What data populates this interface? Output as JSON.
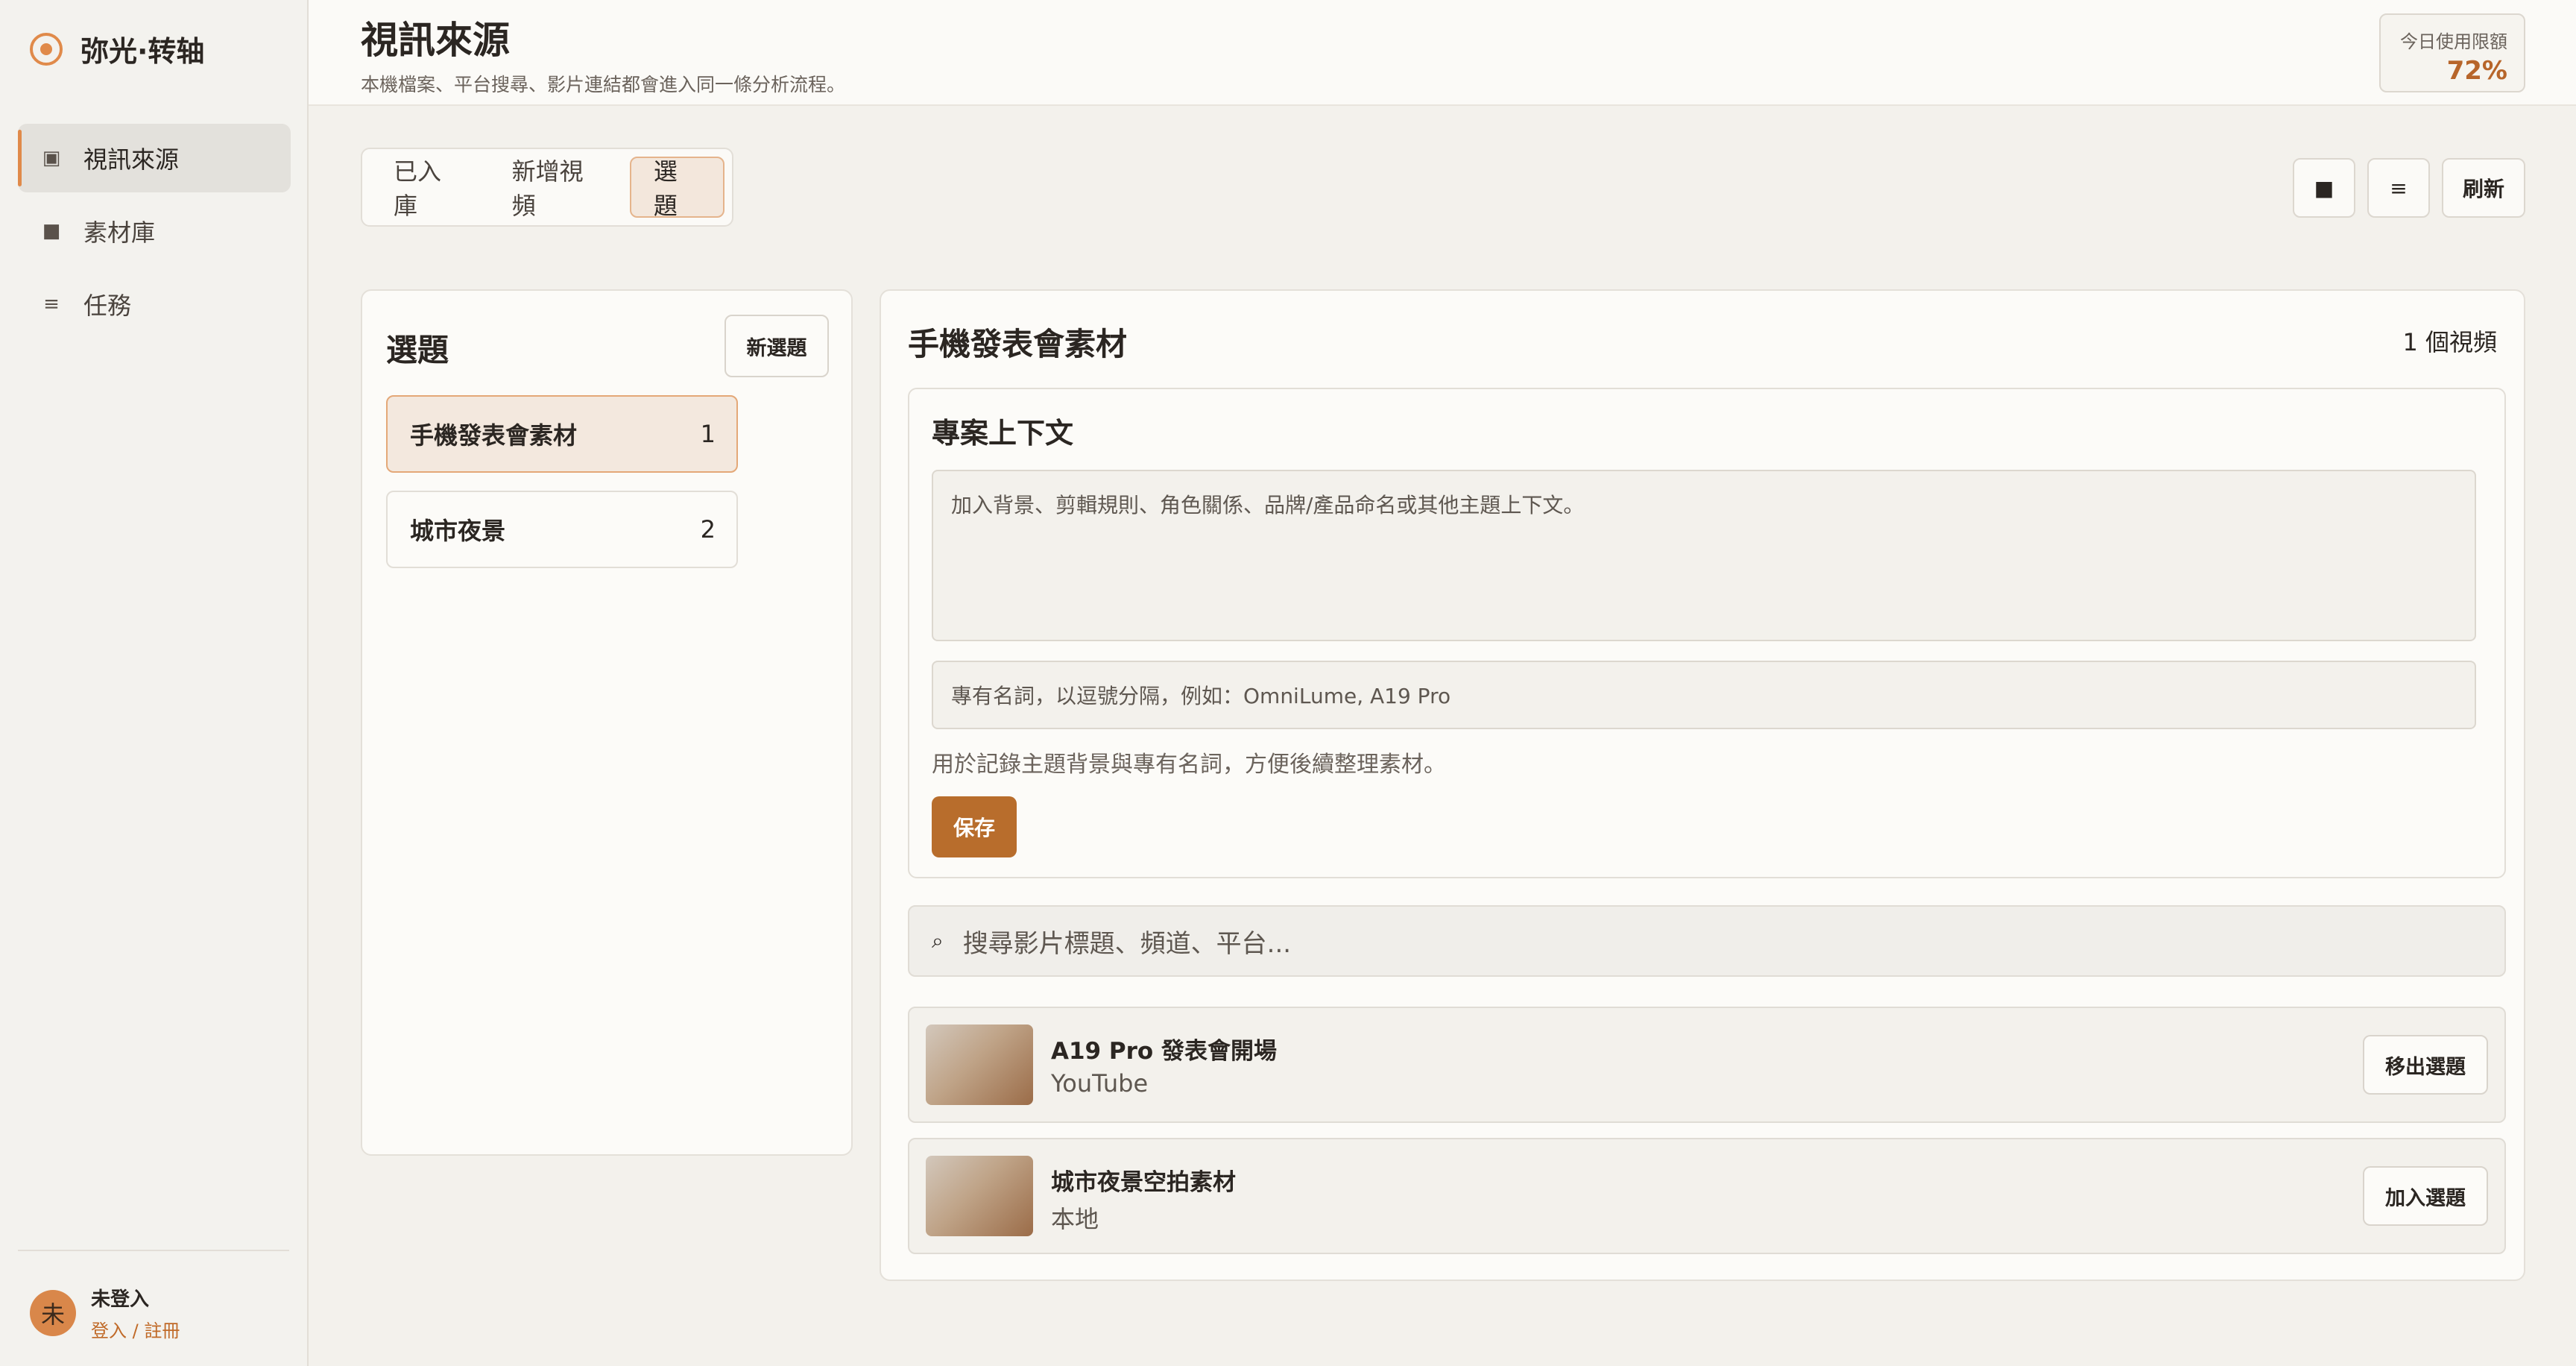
{
  "app": {
    "name": "弥光·转轴"
  },
  "sidebar": {
    "items": [
      {
        "label": "視訊來源",
        "icon": "square-filled-icon",
        "glyph": "▣",
        "active": true
      },
      {
        "label": "素材庫",
        "icon": "square-icon",
        "glyph": "■",
        "active": false
      },
      {
        "label": "任務",
        "icon": "list-icon",
        "glyph": "≡",
        "active": false
      }
    ],
    "user": {
      "avatar": "未",
      "name": "未登入",
      "link": "登入 / 註冊"
    }
  },
  "header": {
    "title": "視訊來源",
    "subtitle": "本機檔案、平台搜尋、影片連結都會進入同一條分析流程。",
    "quota": {
      "label": "今日使用限額",
      "value": "72%"
    }
  },
  "tabs": [
    {
      "label": "已入庫",
      "active": false
    },
    {
      "label": "新增視頻",
      "active": false
    },
    {
      "label": "選題",
      "active": true
    }
  ],
  "toolbar": {
    "grid_glyph": "■",
    "list_glyph": "≡",
    "refresh_label": "刷新"
  },
  "topics": {
    "title": "選題",
    "new_button": "新選題",
    "items": [
      {
        "name": "手機發表會素材",
        "count": "1",
        "active": true
      },
      {
        "name": "城市夜景",
        "count": "2",
        "active": false
      }
    ]
  },
  "detail": {
    "title": "手機發表會素材",
    "count": "1 個視頻",
    "context": {
      "title": "專案上下文",
      "textarea_placeholder": "加入背景、剪輯規則、角色關係、品牌/產品命名或其他主題上下文。",
      "terms_placeholder": "專有名詞，以逗號分隔，例如：OmniLume, A19 Pro",
      "hint": "用於記錄主題背景與專有名詞，方便後續整理素材。",
      "save_label": "保存"
    },
    "search": {
      "icon_glyph": "⌕",
      "placeholder": "搜尋影片標題、頻道、平台..."
    },
    "videos": [
      {
        "title": "A19 Pro 發表會開場",
        "source": "YouTube",
        "action": "移出選題"
      },
      {
        "title": "城市夜景空拍素材",
        "source": "本地",
        "action": "加入選題"
      }
    ]
  },
  "colors": {
    "accent": "#b86d2c",
    "brand": "#e08a4a",
    "background": "#f3f1ec"
  }
}
